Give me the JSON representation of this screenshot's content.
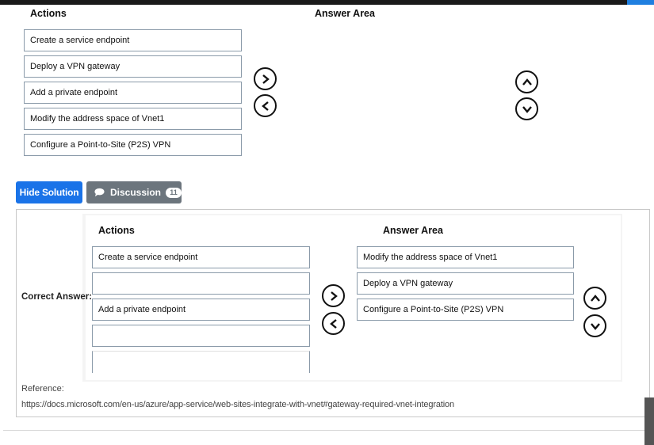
{
  "question": {
    "actions_header": "Actions",
    "answer_header": "Answer Area",
    "actions": [
      "Create a service endpoint",
      "Deploy a VPN gateway",
      "Add a private endpoint",
      "Modify the address space of Vnet1",
      "Configure a Point-to-Site (P2S) VPN"
    ]
  },
  "buttons": {
    "hide_solution": "Hide Solution",
    "discussion": "Discussion",
    "discussion_count": "11"
  },
  "solution": {
    "correct_answer_label": "Correct Answer:",
    "actions_header": "Actions",
    "answer_header": "Answer Area",
    "actions": [
      "Create a service endpoint",
      "",
      "Add a private endpoint",
      "",
      ""
    ],
    "answers": [
      "Modify the address space of Vnet1",
      "Deploy a VPN gateway",
      "Configure a Point-to-Site (P2S) VPN"
    ]
  },
  "reference": {
    "label": "Reference:",
    "url": "https://docs.microsoft.com/en-us/azure/app-service/web-sites-integrate-with-vnet#gateway-required-vnet-integration"
  },
  "colors": {
    "primary": "#1a73e8",
    "secondary": "#6c757d"
  }
}
